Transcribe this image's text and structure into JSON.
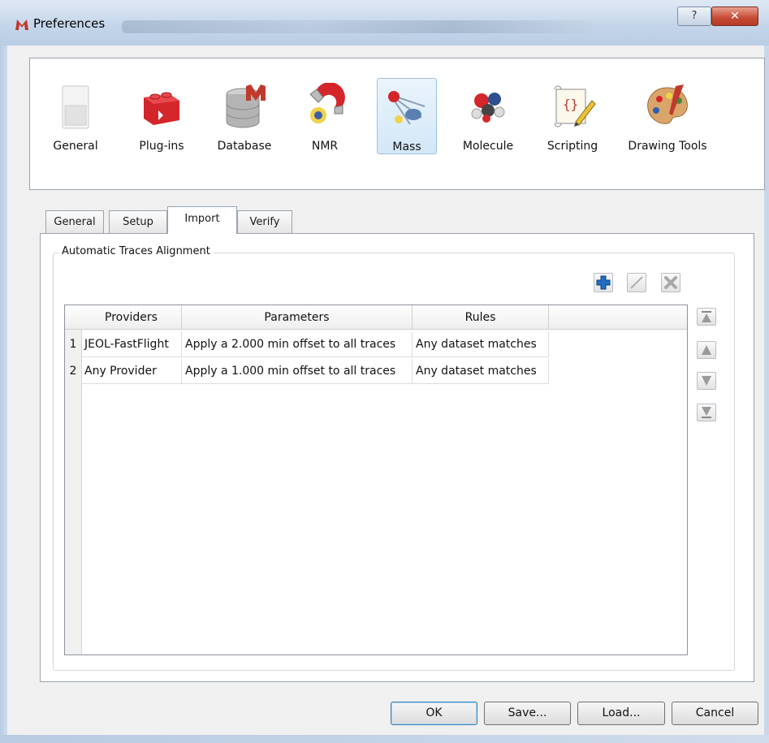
{
  "window": {
    "title": "Preferences",
    "help_glyph": "?",
    "close_glyph": "✕"
  },
  "categories": [
    {
      "label": "General",
      "icon": "switch-icon"
    },
    {
      "label": "Plug-ins",
      "icon": "puzzle-icon"
    },
    {
      "label": "Database",
      "icon": "database-icon"
    },
    {
      "label": "NMR",
      "icon": "magnet-icon"
    },
    {
      "label": "Mass",
      "icon": "mass-spec-icon",
      "selected": true
    },
    {
      "label": "Molecule",
      "icon": "molecule-icon"
    },
    {
      "label": "Scripting",
      "icon": "script-icon"
    },
    {
      "label": "Drawing Tools",
      "icon": "palette-icon"
    }
  ],
  "tabs": [
    {
      "label": "General"
    },
    {
      "label": "Setup"
    },
    {
      "label": "Import",
      "active": true
    },
    {
      "label": "Verify"
    }
  ],
  "group": {
    "title": "Automatic Traces Alignment"
  },
  "table": {
    "columns": [
      "Providers",
      "Parameters",
      "Rules"
    ],
    "rows": [
      {
        "num": "1",
        "provider": "JEOL-FastFlight",
        "parameters": "Apply a 2.000 min offset to all traces",
        "rules": "Any dataset matches"
      },
      {
        "num": "2",
        "provider": "Any Provider",
        "parameters": "Apply a 1.000 min offset to all traces",
        "rules": "Any dataset matches"
      }
    ]
  },
  "buttons": {
    "ok": "OK",
    "save": "Save...",
    "load": "Load...",
    "cancel": "Cancel"
  },
  "colors": {
    "add_blue": "#1f6fc4",
    "selected_bg": "#d3e7f7",
    "close_red": "#c44a33"
  }
}
